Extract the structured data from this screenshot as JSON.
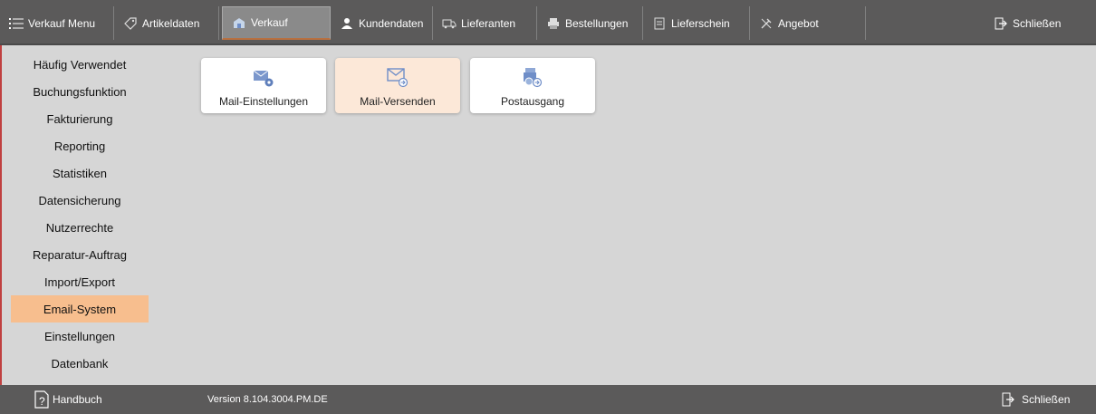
{
  "topnav": {
    "tabs": [
      {
        "label": "Verkauf Menu",
        "icon": "menu-list-icon"
      },
      {
        "label": "Artikeldaten",
        "icon": "tag-icon"
      },
      {
        "label": "Verkauf",
        "icon": "building-icon"
      },
      {
        "label": "Kundendaten",
        "icon": "users-icon"
      },
      {
        "label": "Lieferanten",
        "icon": "truck-icon"
      },
      {
        "label": "Bestellungen",
        "icon": "printer-icon"
      },
      {
        "label": "Lieferschein",
        "icon": "document-icon"
      },
      {
        "label": "Angebot",
        "icon": "tools-icon"
      }
    ],
    "active_tab": "Verkauf",
    "close_label": "Schließen"
  },
  "sidebar": {
    "items": [
      {
        "label": "Häufig Verwendet"
      },
      {
        "label": "Buchungsfunktion"
      },
      {
        "label": "Fakturierung"
      },
      {
        "label": "Reporting"
      },
      {
        "label": "Statistiken"
      },
      {
        "label": "Datensicherung"
      },
      {
        "label": "Nutzerrechte"
      },
      {
        "label": "Reparatur-Auftrag"
      },
      {
        "label": "Import/Export"
      },
      {
        "label": "Email-System"
      },
      {
        "label": "Einstellungen"
      },
      {
        "label": "Datenbank"
      }
    ],
    "active_item": "Email-System"
  },
  "tiles": [
    {
      "label": "Mail-Einstellungen",
      "icon": "mail-settings-icon"
    },
    {
      "label": "Mail-Versenden",
      "icon": "mail-send-icon"
    },
    {
      "label": "Postausgang",
      "icon": "outbox-icon"
    }
  ],
  "active_tile": "Mail-Versenden",
  "footer": {
    "help_label": "Handbuch",
    "version": "Version 8.104.3004.PM.DE",
    "close_label": "Schließen"
  },
  "colors": {
    "bar_bg": "#5b5a5a",
    "content_bg": "#d6d6d6",
    "active_sidebar": "#f7be8e",
    "active_tile": "#fce8d8",
    "icon_blue": "#6f8ec8"
  }
}
